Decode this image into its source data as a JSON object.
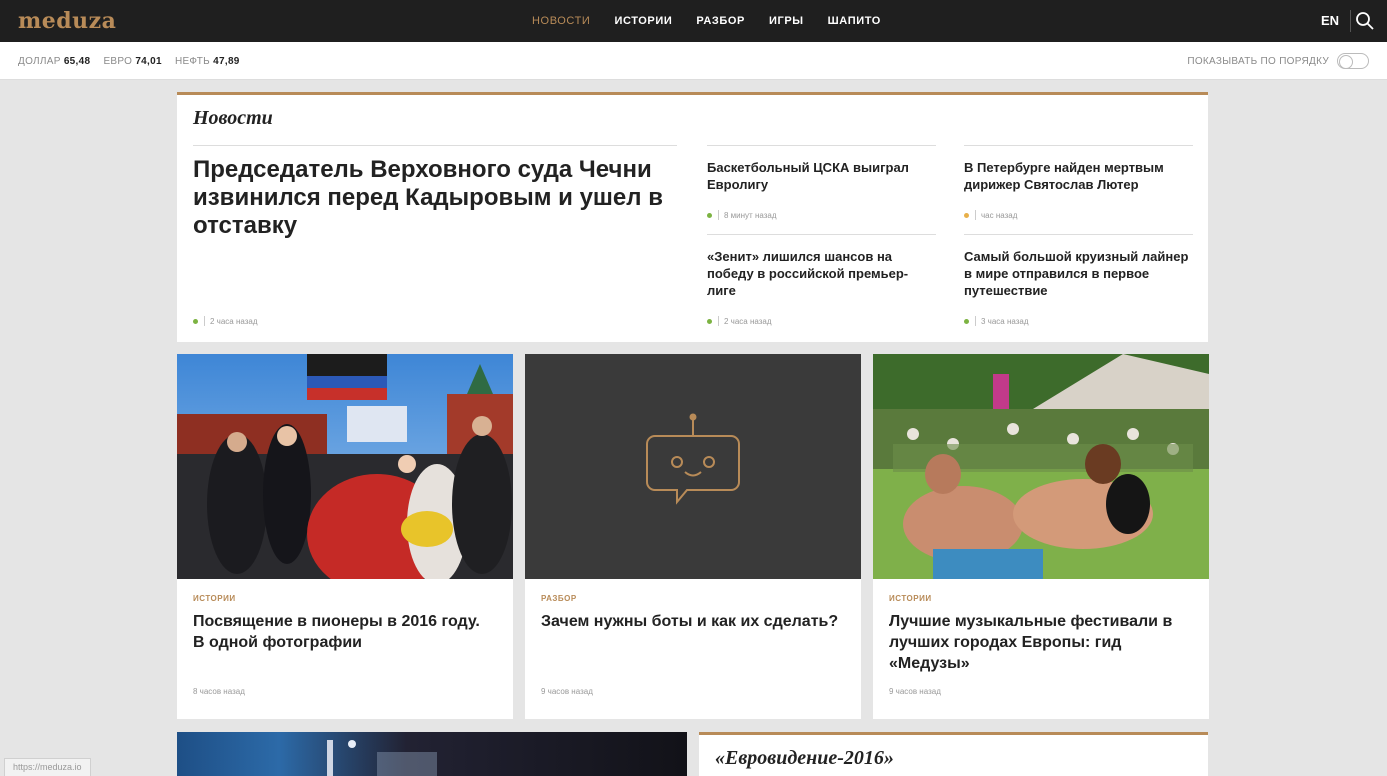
{
  "header": {
    "logo": "meduza",
    "nav": [
      {
        "label": "НОВОСТИ",
        "active": true
      },
      {
        "label": "ИСТОРИИ",
        "active": false
      },
      {
        "label": "РАЗБОР",
        "active": false
      },
      {
        "label": "ИГРЫ",
        "active": false
      },
      {
        "label": "ШАПИТО",
        "active": false
      }
    ],
    "lang": "EN",
    "accent": "#b88b58"
  },
  "infobar": {
    "rates": [
      {
        "label": "ДОЛЛАР",
        "value": "65,48"
      },
      {
        "label": "ЕВРО",
        "value": "74,01"
      },
      {
        "label": "НЕФТЬ",
        "value": "47,89"
      }
    ],
    "order_label": "ПОКАЗЫВАТЬ ПО ПОРЯДКУ"
  },
  "news": {
    "title": "Новости",
    "main": {
      "headline": "Председатель Верховного суда Чечни извинился перед Кадыровым и ушел в отставку",
      "time": "2 часа назад"
    },
    "items": [
      {
        "headline": "Баскетбольный ЦСКА выиграл Евролигу",
        "time": "8 минут назад",
        "dot": "#7cb342"
      },
      {
        "headline": "В Петербурге найден мертвым дирижер Святослав Лютер",
        "time": "час назад",
        "dot": "#e8b04a"
      },
      {
        "headline": "«Зенит» лишился шансов на победу в российской премьер-лиге",
        "time": "2 часа назад",
        "dot": "#7cb342"
      },
      {
        "headline": "Самый большой круизный лайнер в мире отправился в первое путешествие",
        "time": "3 часа назад",
        "dot": "#7cb342"
      }
    ]
  },
  "cards": [
    {
      "tag": "ИСТОРИИ",
      "title": "Посвящение в пионеры в 2016 году. В одной фотографии",
      "time": "8 часов назад"
    },
    {
      "tag": "РАЗБОР",
      "title": "Зачем нужны боты и как их сделать?",
      "time": "9 часов назад"
    },
    {
      "tag": "ИСТОРИИ",
      "title": "Лучшие музыкальные фестивали в лучших городах Европы: гид «Медузы»",
      "time": "9 часов назад"
    }
  ],
  "section_eurovision": "«Евровидение-2016»",
  "status_url": "https://meduza.io"
}
